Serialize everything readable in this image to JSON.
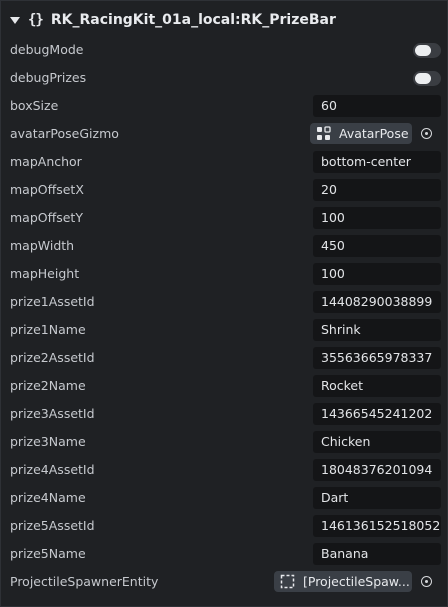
{
  "header": {
    "braces": "{}",
    "title": "RK_RacingKit_01a_local:RK_PrizeBar"
  },
  "rows": {
    "debugMode": {
      "label": "debugMode"
    },
    "debugPrizes": {
      "label": "debugPrizes"
    },
    "boxSize": {
      "label": "boxSize",
      "value": "60"
    },
    "avatarPoseGizmo": {
      "label": "avatarPoseGizmo",
      "value": "AvatarPose"
    },
    "mapAnchor": {
      "label": "mapAnchor",
      "value": "bottom-center"
    },
    "mapOffsetX": {
      "label": "mapOffsetX",
      "value": "20"
    },
    "mapOffsetY": {
      "label": "mapOffsetY",
      "value": "100"
    },
    "mapWidth": {
      "label": "mapWidth",
      "value": "450"
    },
    "mapHeight": {
      "label": "mapHeight",
      "value": "100"
    },
    "prize1AssetId": {
      "label": "prize1AssetId",
      "value": "14408290038899"
    },
    "prize1Name": {
      "label": "prize1Name",
      "value": "Shrink"
    },
    "prize2AssetId": {
      "label": "prize2AssetId",
      "value": "35563665978337"
    },
    "prize2Name": {
      "label": "prize2Name",
      "value": "Rocket"
    },
    "prize3AssetId": {
      "label": "prize3AssetId",
      "value": "14366545241202"
    },
    "prize3Name": {
      "label": "prize3Name",
      "value": "Chicken"
    },
    "prize4AssetId": {
      "label": "prize4AssetId",
      "value": "18048376201094"
    },
    "prize4Name": {
      "label": "prize4Name",
      "value": "Dart"
    },
    "prize5AssetId": {
      "label": "prize5AssetId",
      "value": "146136152518052"
    },
    "prize5Name": {
      "label": "prize5Name",
      "value": "Banana"
    },
    "projectileSpawnerEntity": {
      "label": "ProjectileSpawnerEntity",
      "value": "[ProjectileSpaw..."
    }
  },
  "toggles": {
    "debugMode": false,
    "debugPrizes": false
  },
  "icons": {
    "collapse": "caret-down-icon",
    "avatarPose": "avatar-pose-icon",
    "entity": "entity-dashed-square-icon",
    "target": "target-picker-icon"
  }
}
